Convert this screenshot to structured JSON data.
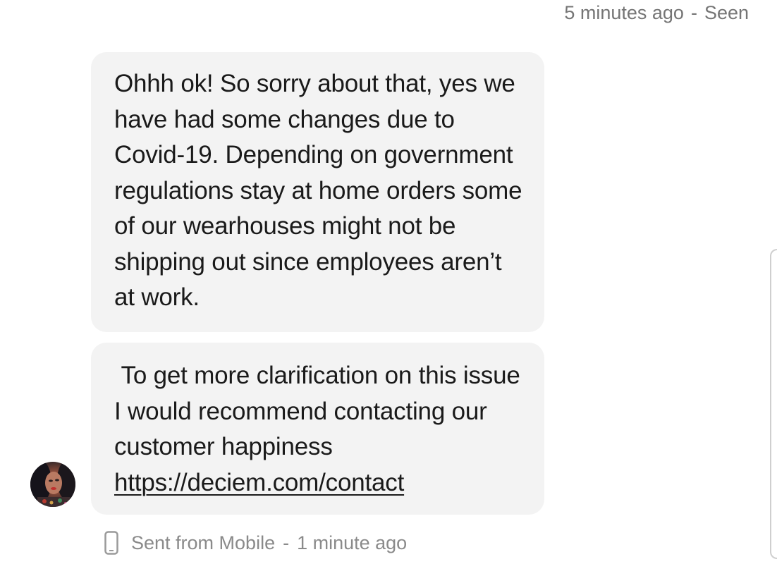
{
  "header": {
    "time_ago": "5 minutes ago",
    "separator": "-",
    "status": "Seen"
  },
  "messages": [
    {
      "text": "Ohhh ok! So sorry about that, yes we have had some changes due to Covid-19. Depending on government regulations stay at home orders some of our wearhouses might not be shipping out since employees aren’t at work."
    },
    {
      "text": " To get more clarification on this issue I would recommend contacting our customer happiness",
      "link": "https://deciem.com/contact"
    }
  ],
  "footer": {
    "icon": "mobile-phone-icon",
    "source": "Sent from Mobile",
    "separator": "-",
    "time_ago": "1 minute ago"
  },
  "colors": {
    "bubble_bg": "#f3f3f3",
    "text": "#1a1a1a",
    "meta_text": "#757575"
  }
}
